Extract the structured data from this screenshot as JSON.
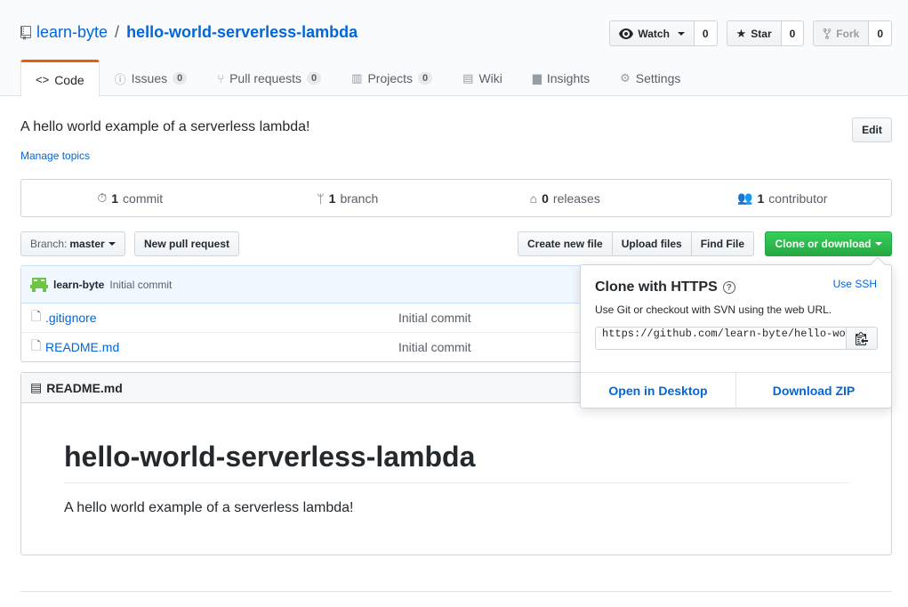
{
  "repo": {
    "owner": "learn-byte",
    "separator": "/",
    "name": "hello-world-serverless-lambda"
  },
  "actions": {
    "watch": {
      "label": "Watch",
      "count": "0"
    },
    "star": {
      "label": "Star",
      "count": "0"
    },
    "fork": {
      "label": "Fork",
      "count": "0"
    }
  },
  "tabs": [
    {
      "label": "Code",
      "icon": "code-icon"
    },
    {
      "label": "Issues",
      "count": "0",
      "icon": "issue-icon"
    },
    {
      "label": "Pull requests",
      "count": "0",
      "icon": "pull-request-icon"
    },
    {
      "label": "Projects",
      "count": "0",
      "icon": "project-icon"
    },
    {
      "label": "Wiki",
      "icon": "book-icon"
    },
    {
      "label": "Insights",
      "icon": "graph-icon"
    },
    {
      "label": "Settings",
      "icon": "gear-icon"
    }
  ],
  "description": "A hello world example of a serverless lambda!",
  "manage_topics": "Manage topics",
  "edit_label": "Edit",
  "summary": {
    "commits": {
      "count": "1",
      "label": "commit"
    },
    "branches": {
      "count": "1",
      "label": "branch"
    },
    "releases": {
      "count": "0",
      "label": "releases"
    },
    "contributors": {
      "count": "1",
      "label": "contributor"
    }
  },
  "file_nav": {
    "branch_prefix": "Branch:",
    "branch": "master",
    "new_pr": "New pull request",
    "create_file": "Create new file",
    "upload_files": "Upload files",
    "find_file": "Find File",
    "clone": "Clone or download"
  },
  "latest_commit": {
    "author": "learn-byte",
    "message": "Initial commit"
  },
  "files": [
    {
      "name": ".gitignore",
      "message": "Initial commit"
    },
    {
      "name": "README.md",
      "message": "Initial commit"
    }
  ],
  "readme": {
    "filename": "README.md",
    "heading": "hello-world-serverless-lambda",
    "body": "A hello world example of a serverless lambda!"
  },
  "clone_popover": {
    "title": "Clone with HTTPS",
    "use_ssh": "Use SSH",
    "description": "Use Git or checkout with SVN using the web URL.",
    "url": "https://github.com/learn-byte/hello-world-serverless-lambda.git",
    "open_desktop": "Open in Desktop",
    "download_zip": "Download ZIP"
  },
  "colors": {
    "link": "#0366d6",
    "accent_tab": "#e36209",
    "clone_green": "#28a745",
    "commit_bar_bg": "#f1f8ff"
  }
}
